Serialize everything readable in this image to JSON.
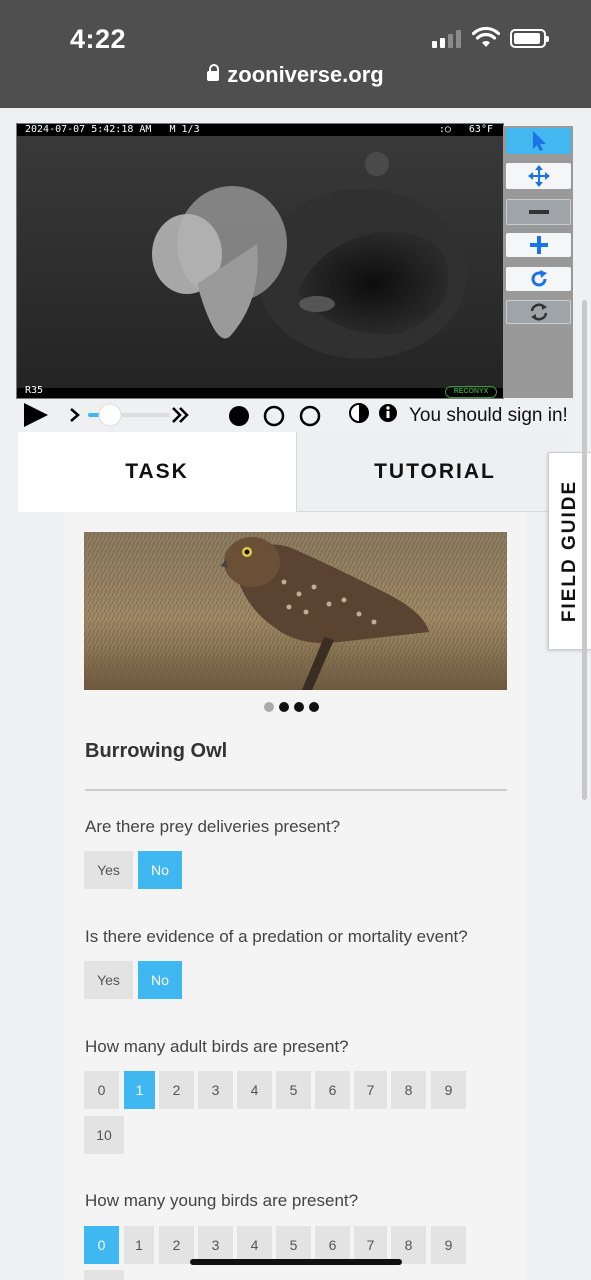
{
  "status_bar": {
    "time": "4:22"
  },
  "browser": {
    "url": "zooniverse.org"
  },
  "camera": {
    "timestamp": "2024-07-07 5:42:18 AM",
    "frame": "M 1/3",
    "temperature": "63°F",
    "camera_id": "R35",
    "brand": "RECONYX"
  },
  "toolbox": {
    "tools": [
      "pointer-icon",
      "move-icon",
      "zoom-out-icon",
      "zoom-in-icon",
      "rotate-icon",
      "reset-icon"
    ]
  },
  "player": {
    "sign_in_text": "You should sign in!"
  },
  "tabs": {
    "task": "TASK",
    "tutorial": "TUTORIAL"
  },
  "field_guide": "FIELD GUIDE",
  "species": {
    "name": "Burrowing Owl",
    "carousel_count": 4,
    "carousel_active": 1
  },
  "questions": [
    {
      "text": "Are there prey deliveries present?",
      "options": [
        "Yes",
        "No"
      ],
      "selected": "No"
    },
    {
      "text": "Is there evidence of a predation or mortality event?",
      "options": [
        "Yes",
        "No"
      ],
      "selected": "No"
    },
    {
      "text": "How many adult birds are present?",
      "options": [
        "0",
        "1",
        "2",
        "3",
        "4",
        "5",
        "6",
        "7",
        "8",
        "9",
        "10"
      ],
      "selected": "1"
    },
    {
      "text": "How many young birds are present?",
      "options": [
        "0",
        "1",
        "2",
        "3",
        "4",
        "5",
        "6",
        "7",
        "8",
        "9"
      ],
      "selected": "0"
    }
  ],
  "colors": {
    "accent": "#3fb8f2",
    "button_bg": "#e3e3e3"
  }
}
